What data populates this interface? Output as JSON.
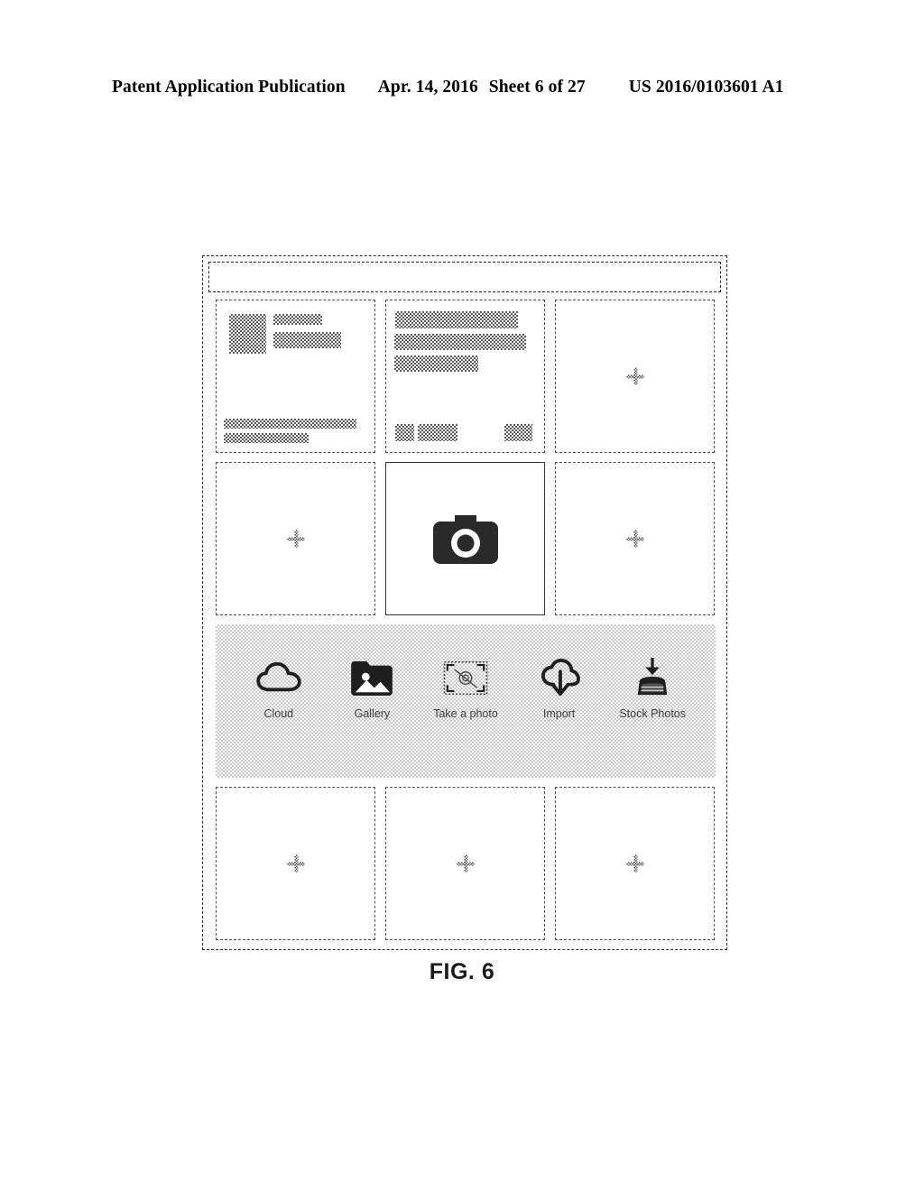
{
  "header": {
    "publication": "Patent Application Publication",
    "date": "Apr. 14, 2016",
    "sheet": "Sheet 6 of 27",
    "number": "US 2016/0103601 A1"
  },
  "figure": {
    "caption": "FIG. 6"
  },
  "app_window": {
    "topbar": {
      "name": "title-bar",
      "text": ""
    },
    "grid": {
      "rows": [
        {
          "cells": [
            {
              "type": "document-thumbnail",
              "label": ""
            },
            {
              "type": "document-thumbnail",
              "label": ""
            },
            {
              "type": "empty-placeholder",
              "label": ""
            }
          ]
        },
        {
          "cells": [
            {
              "type": "empty-placeholder",
              "label": ""
            },
            {
              "type": "camera-selected",
              "label": ""
            },
            {
              "type": "empty-placeholder",
              "label": ""
            }
          ]
        },
        {
          "cells": [
            {
              "type": "empty-placeholder",
              "label": ""
            },
            {
              "type": "empty-placeholder",
              "label": ""
            },
            {
              "type": "empty-placeholder",
              "label": ""
            }
          ]
        }
      ]
    },
    "source_bar": {
      "items": [
        {
          "icon": "cloud-icon",
          "label": "Cloud"
        },
        {
          "icon": "gallery-icon",
          "label": "Gallery"
        },
        {
          "icon": "take-a-photo-icon",
          "label": "Take a photo"
        },
        {
          "icon": "import-icon",
          "label": "Import"
        },
        {
          "icon": "stock-photos-icon",
          "label": "Stock Photos"
        }
      ]
    }
  },
  "colors": {
    "ink": "#1a1a1a",
    "halftone_dark": "#5a5a5a",
    "halftone_light": "#c9c9c9",
    "label_text": "#3c3c3c"
  }
}
